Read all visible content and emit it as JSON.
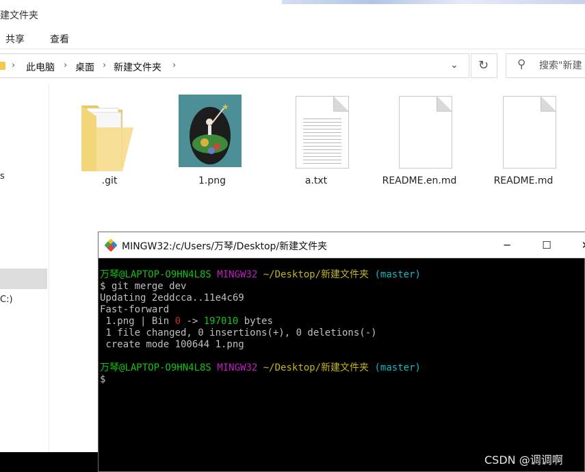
{
  "explorer": {
    "title": "建文件夹",
    "ribbon_tabs": [
      "共享",
      "查看"
    ],
    "breadcrumb": [
      "此电脑",
      "桌面",
      "新建文件夹"
    ],
    "search_placeholder": "搜索\"新建",
    "nav_fragments": [
      "s",
      "C:)"
    ],
    "files": [
      {
        "name": ".git",
        "icon": "folder-icon"
      },
      {
        "name": "1.png",
        "icon": "image-thumbnail"
      },
      {
        "name": "a.txt",
        "icon": "text-file-icon"
      },
      {
        "name": "README.en.md",
        "icon": "document-icon"
      },
      {
        "name": "README.md",
        "icon": "document-icon"
      }
    ]
  },
  "terminal": {
    "title": "MINGW32:/c/Users/万琴/Desktop/新建文件夹",
    "prompt": {
      "user": "万琴@LAPTOP-O9HN4L8S",
      "env": "MINGW32",
      "path": "~/Desktop/新建文件夹",
      "branch": "(master)"
    },
    "command": "$ git merge dev",
    "lines": {
      "updating": "Updating 2eddcca..11e4c69",
      "ff": "Fast-forward",
      "stat_prefix": " 1.png | Bin ",
      "stat_old": "0",
      "stat_arrow": " -> ",
      "stat_new": "197010",
      "stat_suffix": " bytes",
      "changed": " 1 file changed, 0 insertions(+), 0 deletions(-)",
      "create": " create mode 100644 1.png"
    },
    "cursor_prompt": "$",
    "controls": {
      "minimize": "─",
      "maximize": "☐",
      "close": "✕"
    }
  },
  "watermark": "CSDN @调调啊",
  "colors": {
    "prompt_user": "#13c313",
    "prompt_env": "#c41cc4",
    "prompt_path": "#c3b51a",
    "prompt_branch": "#16b8c2"
  }
}
